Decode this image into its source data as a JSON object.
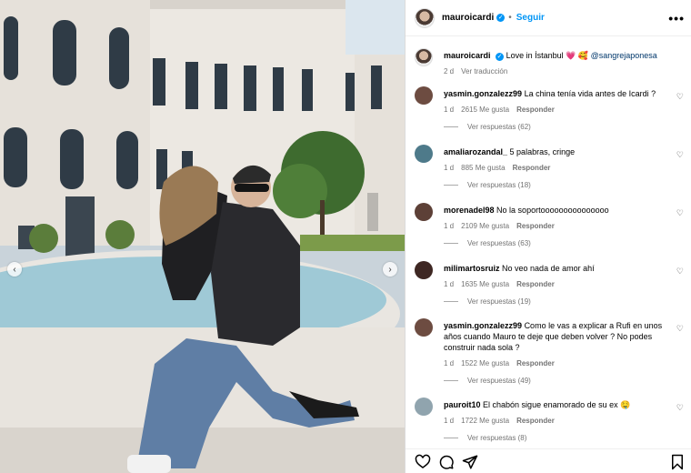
{
  "post": {
    "username": "mauroicardi",
    "follow_label": "Seguir",
    "separator": "•",
    "more_label": "•••",
    "verified_mark": "✓"
  },
  "caption": {
    "username": "mauroicardi",
    "text": "Love in İstanbul",
    "emoji": "💗 🥰",
    "mention": "@sangrejaponesa",
    "time": "2 d",
    "translate": "Ver traducción"
  },
  "comments": [
    {
      "username": "yasmin.gonzalezz99",
      "text": "La china tenía vida antes de Icardi ?",
      "time": "1 d",
      "likes": "2615 Me gusta",
      "reply": "Responder",
      "replies": "Ver respuestas (62)",
      "avatar_color": "#6d4c41"
    },
    {
      "username": "amaliarozandal_",
      "text": "5 palabras, cringe",
      "time": "1 d",
      "likes": "885 Me gusta",
      "reply": "Responder",
      "replies": "Ver respuestas (18)",
      "avatar_color": "#4e7a8a"
    },
    {
      "username": "morenadel98",
      "text": "No la soportooooooooooooooo",
      "time": "1 d",
      "likes": "2109 Me gusta",
      "reply": "Responder",
      "replies": "Ver respuestas (63)",
      "avatar_color": "#5d4037"
    },
    {
      "username": "milimartosruiz",
      "text": "No veo nada de amor ahí",
      "time": "1 d",
      "likes": "1635 Me gusta",
      "reply": "Responder",
      "replies": "Ver respuestas (19)",
      "avatar_color": "#3e2723"
    },
    {
      "username": "yasmin.gonzalezz99",
      "text": "Como le vas a explicar a Rufi en unos años cuando Mauro te deje que deben volver ? No podes construir nada sola ?",
      "time": "1 d",
      "likes": "1522 Me gusta",
      "reply": "Responder",
      "replies": "Ver respuestas (49)",
      "avatar_color": "#6d4c41"
    },
    {
      "username": "pauroit10",
      "text": "El chabón sigue enamorado de su ex",
      "emoji": "🤤",
      "time": "1 d",
      "likes": "1722 Me gusta",
      "reply": "Responder",
      "replies": "Ver respuestas (8)",
      "avatar_color": "#90a4ae"
    }
  ],
  "icons": {
    "like": "heart-icon",
    "comment": "comment-icon",
    "share": "send-icon",
    "save": "bookmark-icon",
    "prev": "chevron-left-icon",
    "next": "chevron-right-icon"
  },
  "nav": {
    "prev": "‹",
    "next": "›"
  },
  "colors": {
    "accent": "#0095f6",
    "muted": "#737373",
    "mention": "#00376b"
  }
}
